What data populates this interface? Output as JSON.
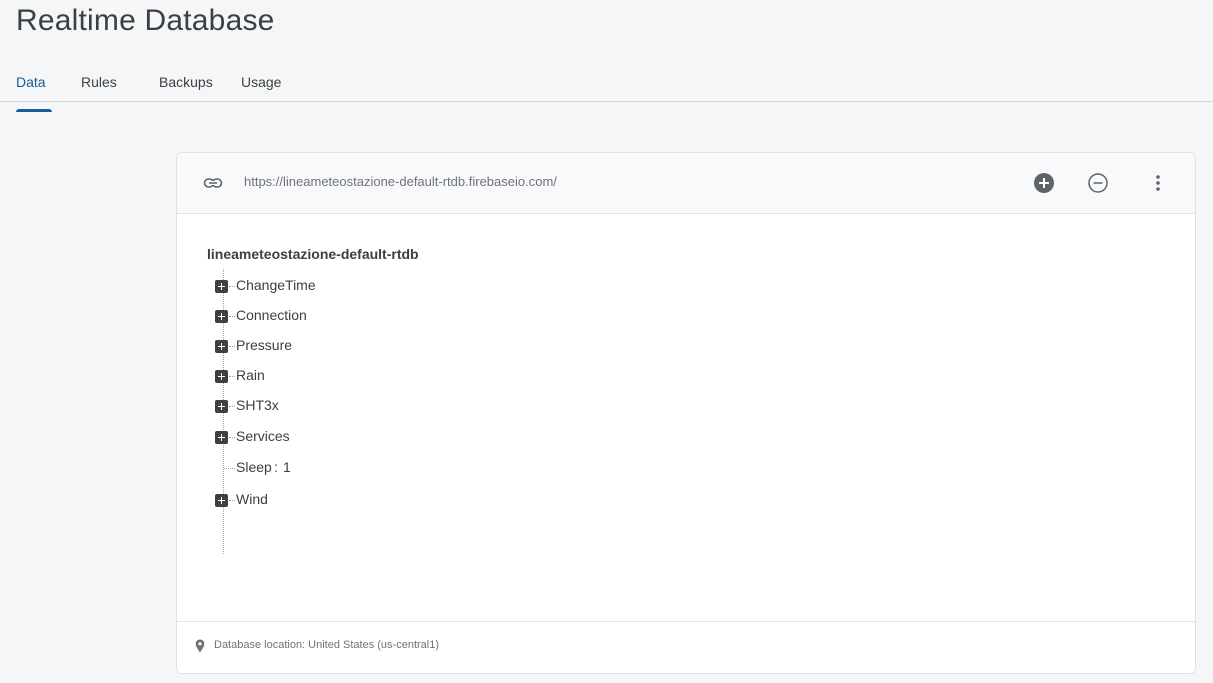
{
  "page": {
    "title": "Realtime Database"
  },
  "tabs": [
    {
      "label": "Data",
      "active": true
    },
    {
      "label": "Rules",
      "active": false
    },
    {
      "label": "Backups",
      "active": false
    },
    {
      "label": "Usage",
      "active": false
    }
  ],
  "database": {
    "url": "https://lineameteostazione-default-rtdb.firebaseio.com/",
    "header_icons": {
      "link": "link-icon",
      "add": "add-circle-icon",
      "remove": "remove-circle-icon",
      "more": "more-vert-icon"
    },
    "root": "lineameteostazione-default-rtdb",
    "nodes": [
      {
        "key": "ChangeTime",
        "expandable": true
      },
      {
        "key": "Connection",
        "expandable": true
      },
      {
        "key": "Pressure",
        "expandable": true
      },
      {
        "key": "Rain",
        "expandable": true
      },
      {
        "key": "SHT3x",
        "expandable": true
      },
      {
        "key": "Services",
        "expandable": true
      },
      {
        "key": "Sleep",
        "separator": ":",
        "value": "1",
        "expandable": false
      },
      {
        "key": "Wind",
        "expandable": true
      }
    ],
    "location_label": "Database location: United States (us-central1)"
  },
  "colors": {
    "accent": "#1a5c9a",
    "text": "#3c4043",
    "muted": "#6f7378"
  }
}
